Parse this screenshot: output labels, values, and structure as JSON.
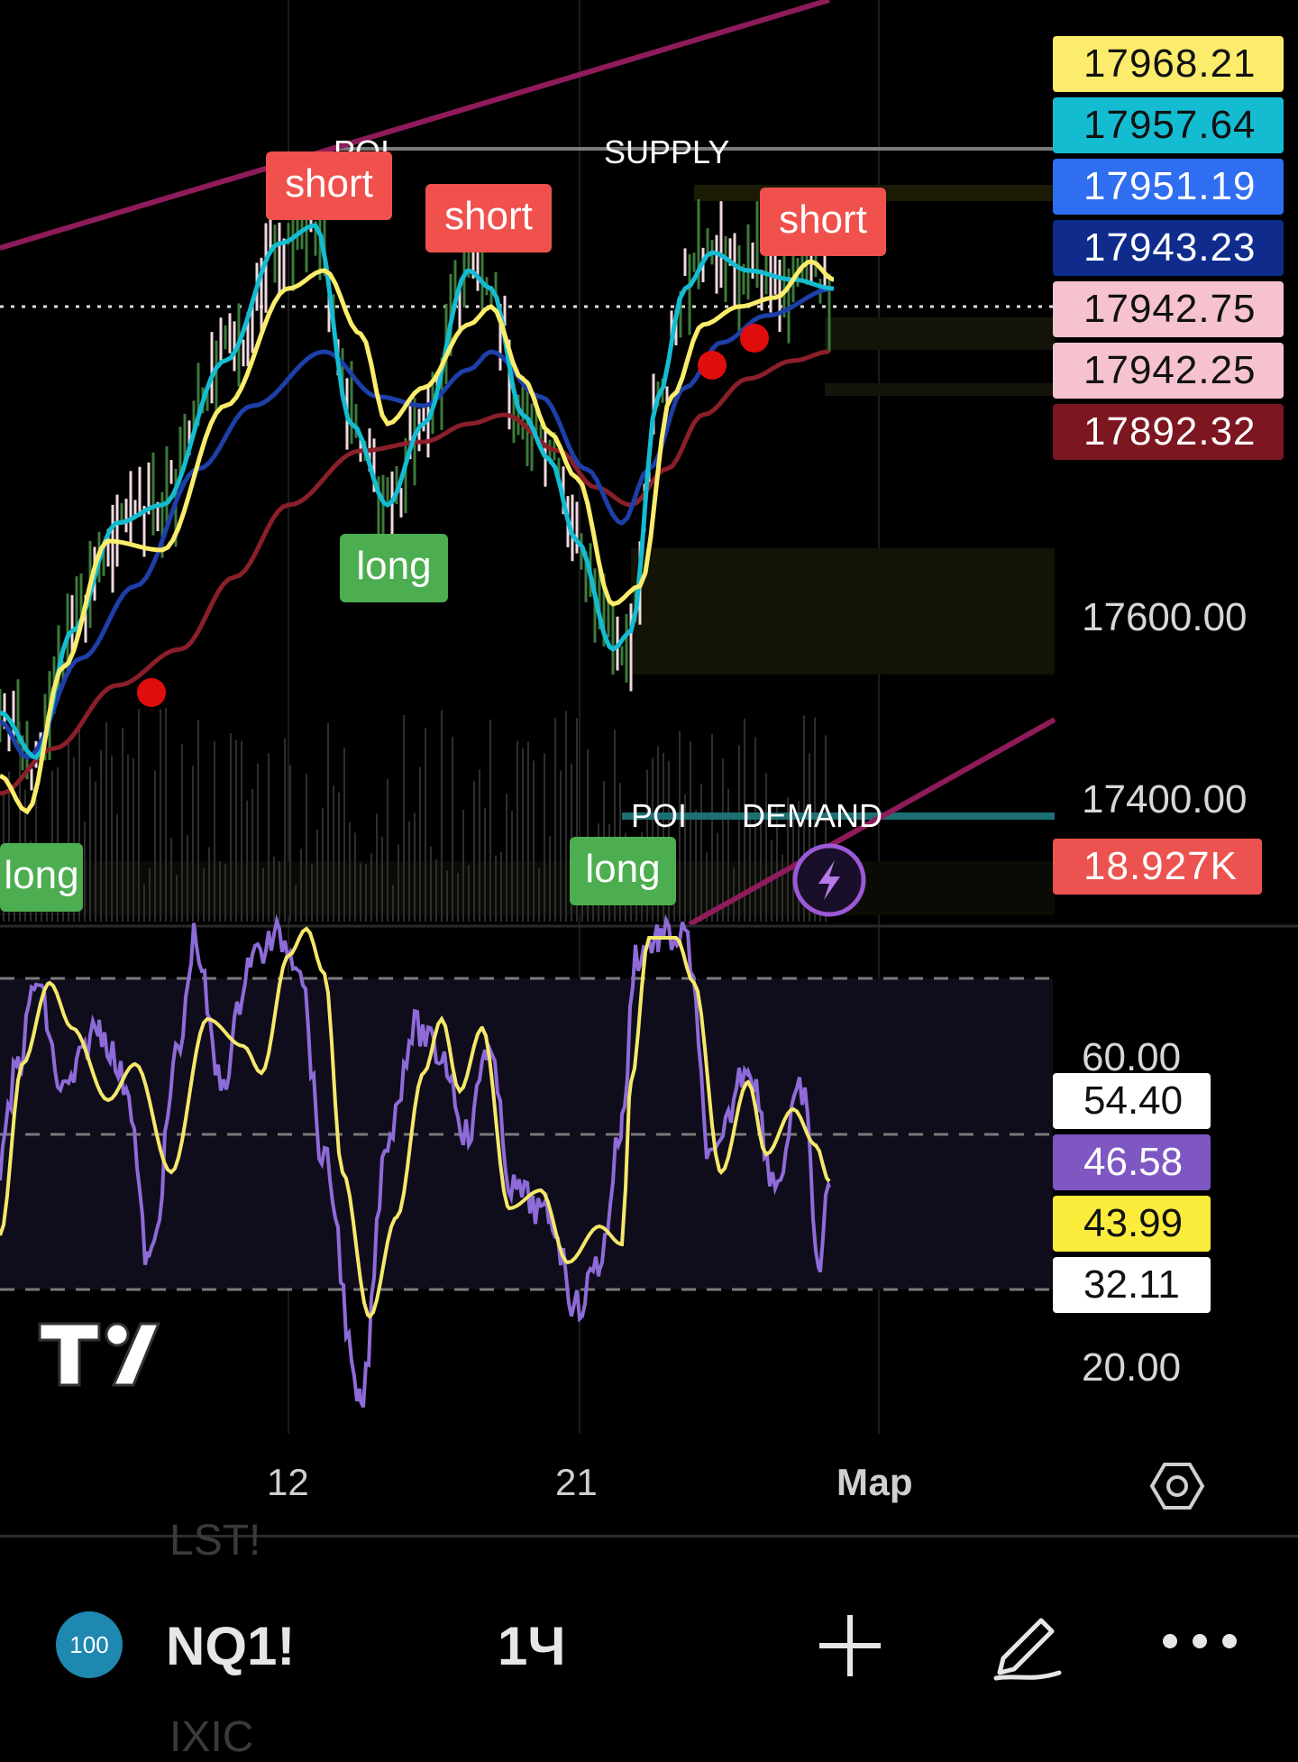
{
  "price_axis": {
    "labels": [
      "17600.00",
      "17400.00"
    ],
    "tags": [
      {
        "value": "17968.21",
        "bg": "#fbec6b",
        "fg": "#111111"
      },
      {
        "value": "17957.64",
        "bg": "#14bcd1",
        "fg": "#111111"
      },
      {
        "value": "17951.19",
        "bg": "#2f6ef0",
        "fg": "#ffffff"
      },
      {
        "value": "17943.23",
        "bg": "#0f2c8c",
        "fg": "#ffffff"
      },
      {
        "value": "17942.75",
        "bg": "#f6c2d0",
        "fg": "#111111"
      },
      {
        "value": "17942.25",
        "bg": "#f6c2d0",
        "fg": "#111111"
      },
      {
        "value": "17892.32",
        "bg": "#7c1620",
        "fg": "#ffffff"
      }
    ],
    "volume_tag": {
      "value": "18.927K",
      "bg": "#ec5350",
      "fg": "#ffffff"
    }
  },
  "annotations": {
    "poi_top": "POI",
    "supply": "SUPPLY",
    "poi_bottom": "POI",
    "demand": "DEMAND",
    "signals": [
      {
        "type": "short",
        "text": "short"
      },
      {
        "type": "short",
        "text": "short"
      },
      {
        "type": "short",
        "text": "short"
      },
      {
        "type": "long",
        "text": "long"
      },
      {
        "type": "long",
        "text": "long"
      },
      {
        "type": "long",
        "text": "long"
      }
    ]
  },
  "oscillator": {
    "axis_labels": [
      "60.00",
      "20.00"
    ],
    "tags": [
      {
        "value": "54.40",
        "bg": "#ffffff",
        "fg": "#111111"
      },
      {
        "value": "46.58",
        "bg": "#7e57c2",
        "fg": "#ffffff"
      },
      {
        "value": "43.99",
        "bg": "#fbec3b",
        "fg": "#111111"
      },
      {
        "value": "32.11",
        "bg": "#ffffff",
        "fg": "#111111"
      }
    ]
  },
  "time_axis": {
    "labels": [
      "12",
      "21",
      "Мар"
    ]
  },
  "settings_icon": "settings-hexagon-icon",
  "bottom_bar": {
    "badge": "100",
    "symbol": "NQ1!",
    "interval": "1Ч",
    "add_icon": "plus-icon",
    "draw_icon": "pencil-icon",
    "more_icon": "more-dots-icon"
  },
  "ghost_text": {
    "top": "LST!",
    "bottom": "IXIC"
  },
  "colors": {
    "background": "#000000",
    "ema_yellow": "#fbec6b",
    "ema_cyan": "#14bcd1",
    "ema_blue": "#1d3fa8",
    "ema_maroon": "#8a1f2a",
    "channel": "#8e1b5a",
    "rsi_purple": "#8e6bd8",
    "rsi_signal": "#f5e86a"
  }
}
